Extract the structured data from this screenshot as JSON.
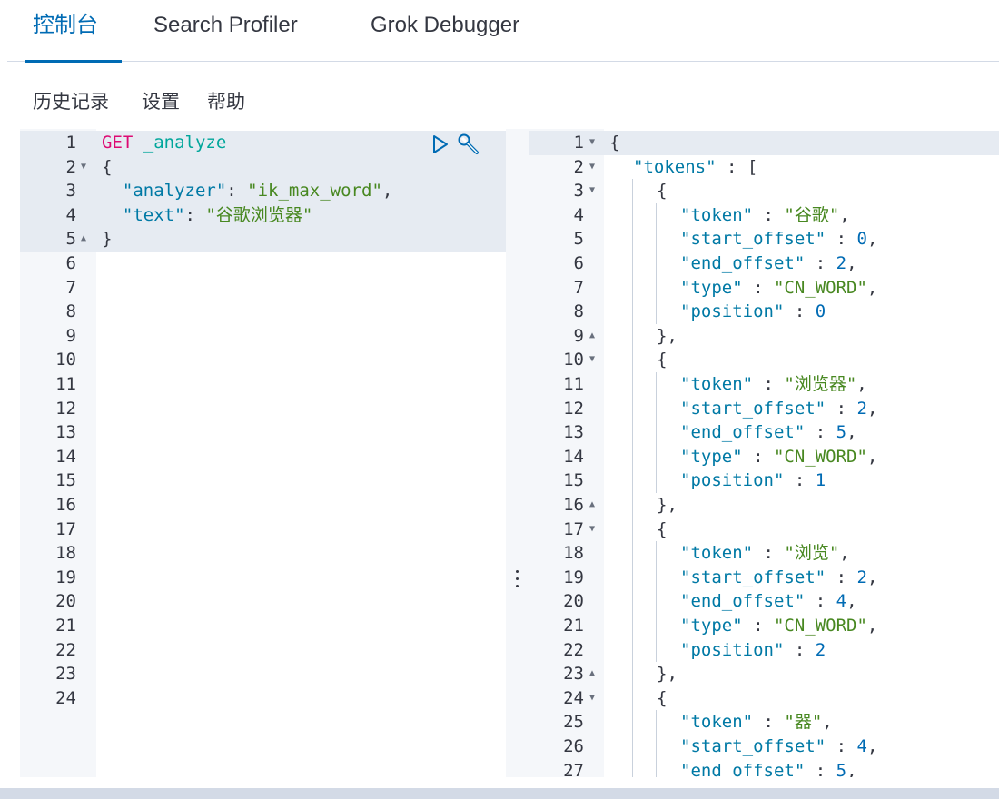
{
  "tabs": [
    {
      "label": "控制台",
      "active": true
    },
    {
      "label": "Search Profiler",
      "active": false
    },
    {
      "label": "Grok Debugger",
      "active": false
    }
  ],
  "menu": [
    {
      "label": "历史记录"
    },
    {
      "label": "设置"
    },
    {
      "label": "帮助"
    }
  ],
  "request": {
    "lines": [
      "1",
      "2",
      "3",
      "4",
      "5",
      "6",
      "7",
      "8",
      "9",
      "10",
      "11",
      "12",
      "13",
      "14",
      "15",
      "16",
      "17",
      "18",
      "19",
      "20",
      "21",
      "22",
      "23",
      "24"
    ],
    "method": "GET",
    "endpoint": "_analyze",
    "brace_open": "{",
    "brace_close": "}",
    "analyzer_key": "\"analyzer\"",
    "analyzer_value": "\"ik_max_word\"",
    "text_key": "\"text\"",
    "text_value": "\"谷歌浏览器\"",
    "icons": [
      "play-icon",
      "wrench-icon"
    ]
  },
  "response": {
    "lines": [
      "1",
      "2",
      "3",
      "4",
      "5",
      "6",
      "7",
      "8",
      "9",
      "10",
      "11",
      "12",
      "13",
      "14",
      "15",
      "16",
      "17",
      "18",
      "19",
      "20",
      "21",
      "22",
      "23",
      "24",
      "25",
      "26",
      "27"
    ],
    "tokens_key": "\"tokens\"",
    "tokens": [
      {
        "token": "\"谷歌\"",
        "start_offset": "0",
        "end_offset": "2",
        "type": "\"CN_WORD\"",
        "position": "0"
      },
      {
        "token": "\"浏览器\"",
        "start_offset": "2",
        "end_offset": "5",
        "type": "\"CN_WORD\"",
        "position": "1"
      },
      {
        "token": "\"浏览\"",
        "start_offset": "2",
        "end_offset": "4",
        "type": "\"CN_WORD\"",
        "position": "2"
      },
      {
        "token": "\"器\"",
        "start_offset": "4",
        "end_offset": "5"
      }
    ],
    "keys": {
      "token": "\"token\"",
      "start_offset": "\"start_offset\"",
      "end_offset": "\"end_offset\"",
      "type": "\"type\"",
      "position": "\"position\""
    }
  },
  "colors": {
    "accent": "#006bb4",
    "method": "#dd0a73",
    "url": "#00a69b",
    "key": "#0079a5"
  }
}
